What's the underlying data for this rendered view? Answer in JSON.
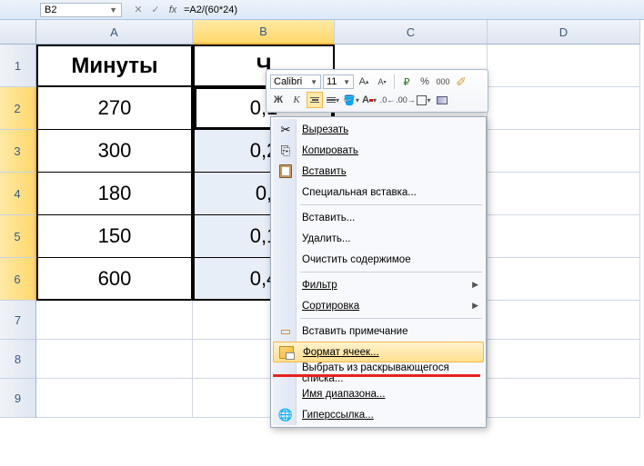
{
  "namebox": {
    "cell": "B2"
  },
  "formula": "=A2/(60*24)",
  "columns": [
    "A",
    "B",
    "C",
    "D"
  ],
  "rows": [
    "1",
    "2",
    "3",
    "4",
    "5",
    "6",
    "7",
    "8",
    "9"
  ],
  "headers": {
    "A": "Минуты",
    "B": "Ч"
  },
  "data": {
    "A": [
      "270",
      "300",
      "180",
      "150",
      "600"
    ],
    "B": [
      "0,1",
      "0,2",
      "0,",
      "0,1",
      "0,4"
    ]
  },
  "mini": {
    "font": "Calibri",
    "size": "11",
    "bold": "Ж",
    "ital": "К",
    "pct": "%",
    "thou": "000",
    "A": "A"
  },
  "ctx": {
    "cut": "Вырезать",
    "copy": "Копировать",
    "paste": "Вставить",
    "paste_special": "Специальная вставка...",
    "insert": "Вставить...",
    "delete": "Удалить...",
    "clear": "Очистить содержимое",
    "filter": "Фильтр",
    "sort": "Сортировка",
    "comment": "Вставить примечание",
    "format": "Формат ячеек...",
    "dropdown": "Выбрать из раскрывающегося списка...",
    "rangename": "Имя диапазона...",
    "hyperlink": "Гиперссылка..."
  }
}
